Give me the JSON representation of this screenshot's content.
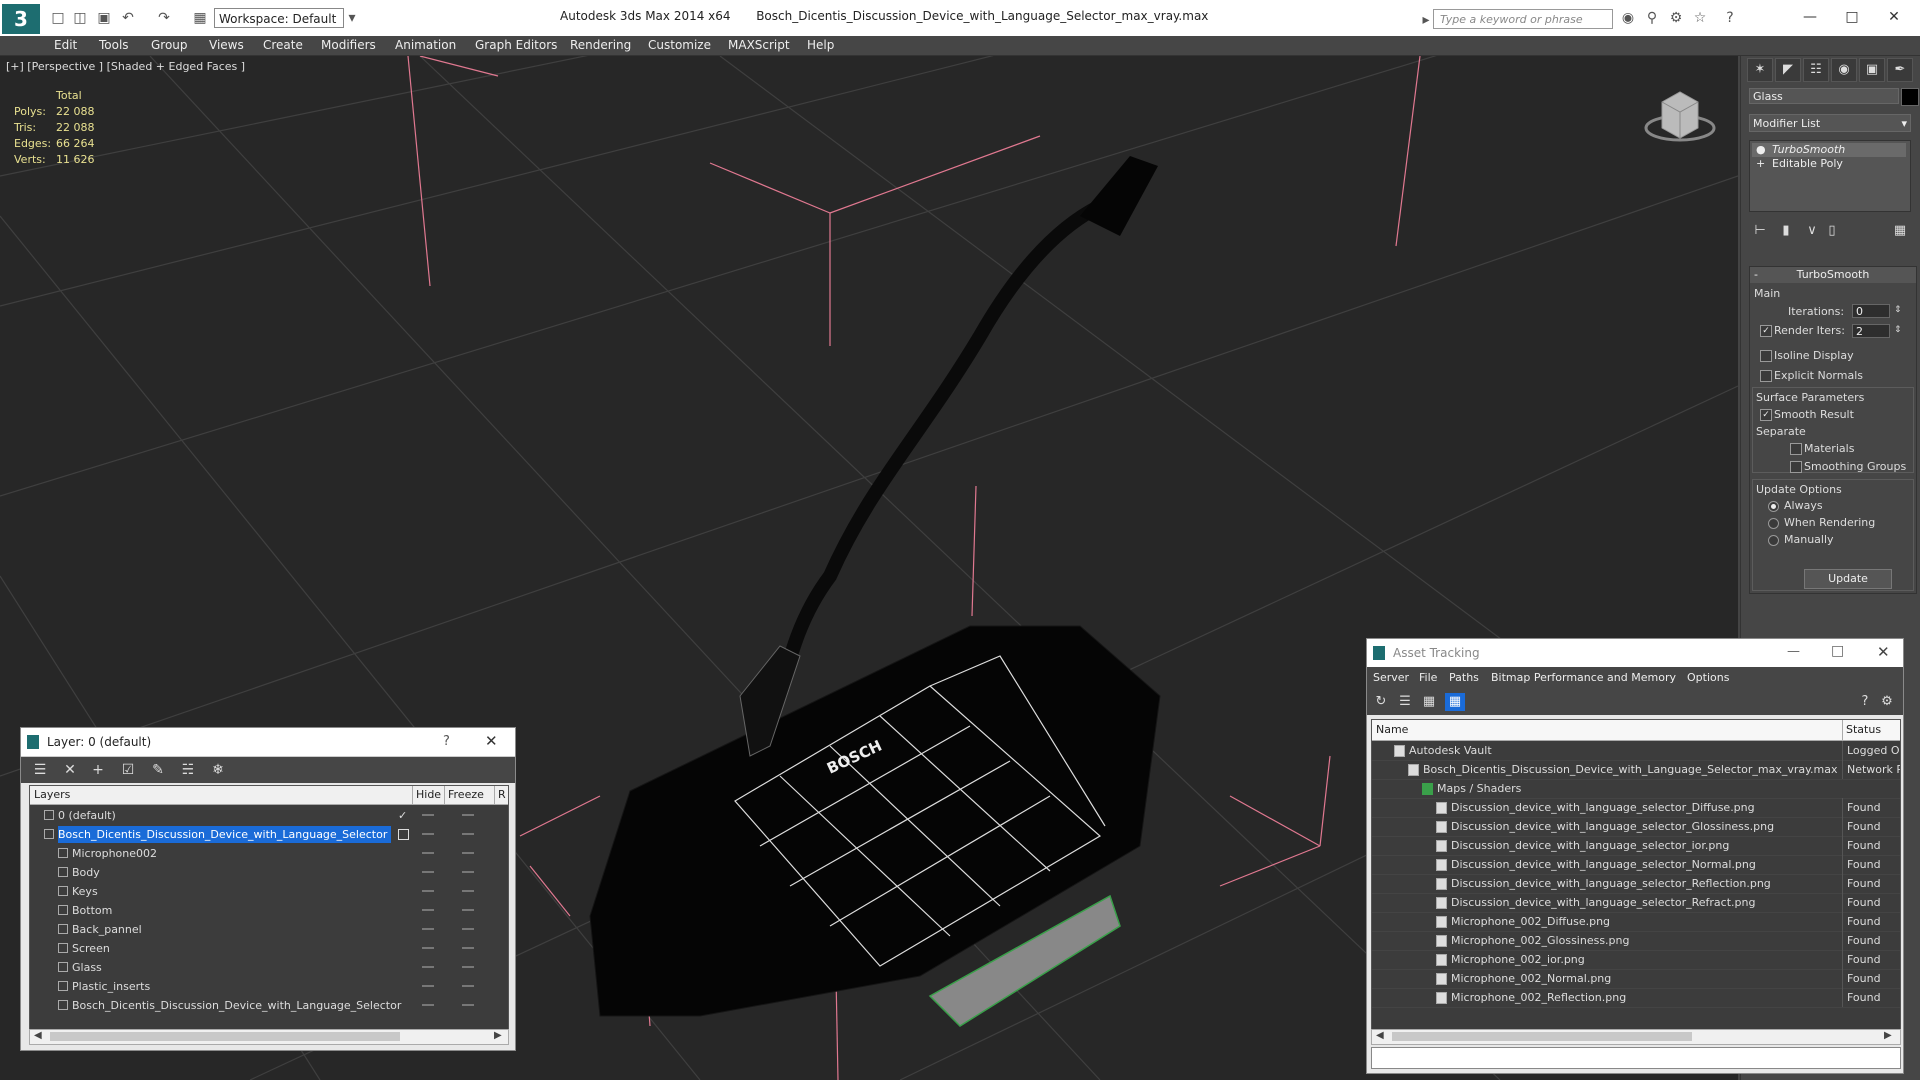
{
  "titlebar": {
    "logo": "3",
    "workspace": "Workspace: Default",
    "app_title": "Autodesk 3ds Max  2014 x64",
    "file_title": "Bosch_Dicentis_Discussion_Device_with_Language_Selector_max_vray.max",
    "search_placeholder": "Type a keyword or phrase"
  },
  "menu": [
    "Edit",
    "Tools",
    "Group",
    "Views",
    "Create",
    "Modifiers",
    "Animation",
    "Graph Editors",
    "Rendering",
    "Customize",
    "MAXScript",
    "Help"
  ],
  "viewport": {
    "label": "[+] [Perspective ] [Shaded + Edged Faces ]",
    "stats": {
      "header": "Total",
      "rows": [
        {
          "label": "Polys:",
          "value": "22 088"
        },
        {
          "label": "Tris:",
          "value": "22 088"
        },
        {
          "label": "Edges:",
          "value": "66 264"
        },
        {
          "label": "Verts:",
          "value": "11 626"
        }
      ]
    },
    "brand_text": "BOSCH"
  },
  "command_panel": {
    "object_name": "Glass",
    "modifier_list": "Modifier List",
    "stack": [
      "TurboSmooth",
      "Editable Poly"
    ],
    "turbosmooth": {
      "title": "TurboSmooth",
      "main": "Main",
      "iterations_label": "Iterations:",
      "iterations_value": "0",
      "render_iters_label": "Render Iters:",
      "render_iters_value": "2",
      "isoline": "Isoline Display",
      "explicit": "Explicit Normals",
      "surface_params": "Surface Parameters",
      "smooth_result": "Smooth Result",
      "separate": "Separate",
      "materials": "Materials",
      "smoothing_groups": "Smoothing Groups",
      "update_options": "Update Options",
      "always": "Always",
      "when_rendering": "When Rendering",
      "manually": "Manually",
      "update_button": "Update"
    }
  },
  "layer_dialog": {
    "title": "Layer: 0 (default)",
    "help": "?",
    "columns": {
      "layers": "Layers",
      "hide": "Hide",
      "freeze": "Freeze",
      "r": "R"
    },
    "rows": [
      {
        "name": "0 (default)",
        "indent": 0
      },
      {
        "name": "Bosch_Dicentis_Discussion_Device_with_Language_Selector",
        "indent": 0,
        "selected": true
      },
      {
        "name": "Microphone002",
        "indent": 1
      },
      {
        "name": "Body",
        "indent": 1
      },
      {
        "name": "Keys",
        "indent": 1
      },
      {
        "name": "Bottom",
        "indent": 1
      },
      {
        "name": "Back_pannel",
        "indent": 1
      },
      {
        "name": "Screen",
        "indent": 1
      },
      {
        "name": "Glass",
        "indent": 1
      },
      {
        "name": "Plastic_inserts",
        "indent": 1
      },
      {
        "name": "Bosch_Dicentis_Discussion_Device_with_Language_Selector",
        "indent": 1
      }
    ]
  },
  "asset_dialog": {
    "title": "Asset Tracking",
    "menu": [
      "Server",
      "File",
      "Paths",
      "Bitmap Performance and Memory",
      "Options"
    ],
    "columns": {
      "name": "Name",
      "status": "Status"
    },
    "rows": [
      {
        "name": "Autodesk Vault",
        "status": "Logged Ou",
        "indent": 1
      },
      {
        "name": "Bosch_Dicentis_Discussion_Device_with_Language_Selector_max_vray.max",
        "status": "Network P",
        "indent": 2
      },
      {
        "name": "Maps / Shaders",
        "status": "",
        "indent": 3
      },
      {
        "name": "Discussion_device_with_language_selector_Diffuse.png",
        "status": "Found",
        "indent": 4
      },
      {
        "name": "Discussion_device_with_language_selector_Glossiness.png",
        "status": "Found",
        "indent": 4
      },
      {
        "name": "Discussion_device_with_language_selector_ior.png",
        "status": "Found",
        "indent": 4
      },
      {
        "name": "Discussion_device_with_language_selector_Normal.png",
        "status": "Found",
        "indent": 4
      },
      {
        "name": "Discussion_device_with_language_selector_Reflection.png",
        "status": "Found",
        "indent": 4
      },
      {
        "name": "Discussion_device_with_language_selector_Refract.png",
        "status": "Found",
        "indent": 4
      },
      {
        "name": "Microphone_002_Diffuse.png",
        "status": "Found",
        "indent": 4
      },
      {
        "name": "Microphone_002_Glossiness.png",
        "status": "Found",
        "indent": 4
      },
      {
        "name": "Microphone_002_ior.png",
        "status": "Found",
        "indent": 4
      },
      {
        "name": "Microphone_002_Normal.png",
        "status": "Found",
        "indent": 4
      },
      {
        "name": "Microphone_002_Reflection.png",
        "status": "Found",
        "indent": 4
      }
    ]
  },
  "colors": {
    "accent": "#1a6bd8",
    "stats": "#e8e090",
    "viewport_bg": "#272727",
    "panel": "#464646"
  }
}
